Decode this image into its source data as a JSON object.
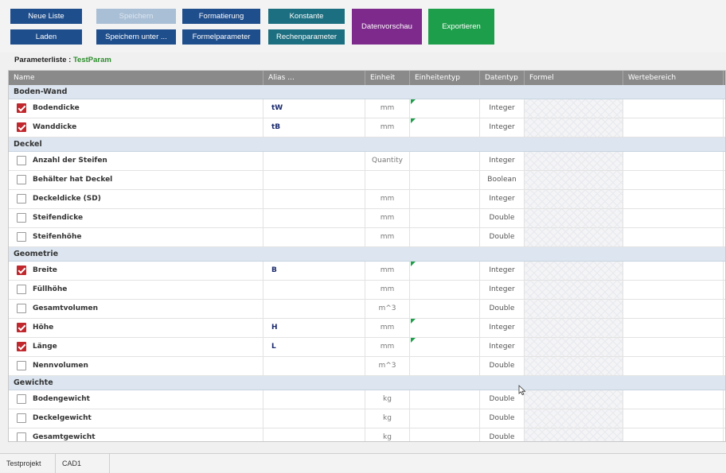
{
  "toolbar": {
    "neue_liste": "Neue Liste",
    "speichern": "Speichern",
    "formatierung": "Formatierung",
    "konstante": "Konstante",
    "laden": "Laden",
    "speichern_unter": "Speichern unter ...",
    "formelparameter": "Formelparameter",
    "rechenparameter": "Rechenparameter",
    "datenvorschau": "Datenvorschau",
    "exportieren": "Exportieren"
  },
  "param_list": {
    "label": "Parameterliste :",
    "name": "TestParam"
  },
  "columns": {
    "name": "Name",
    "alias": "Alias ...",
    "einheit": "Einheit",
    "einheitentyp": "Einheitentyp",
    "datentyp": "Datentyp",
    "formel": "Formel",
    "wertebereich": "Wertebereich"
  },
  "groups": [
    {
      "label": "Boden-Wand",
      "rows": [
        {
          "name": "Bodendicke",
          "checked": true,
          "alias": "tW",
          "unit": "mm",
          "dtype": "Integer",
          "marker": true
        },
        {
          "name": "Wanddicke",
          "checked": true,
          "alias": "tB",
          "unit": "mm",
          "dtype": "Integer",
          "marker": true
        }
      ]
    },
    {
      "label": "Deckel",
      "rows": [
        {
          "name": "Anzahl der Steifen",
          "checked": false,
          "alias": "",
          "unit": "Quantity",
          "dtype": "Integer",
          "marker": false
        },
        {
          "name": "Behälter hat Deckel",
          "checked": false,
          "alias": "",
          "unit": "",
          "dtype": "Boolean",
          "marker": false
        },
        {
          "name": "Deckeldicke (SD)",
          "checked": false,
          "alias": "",
          "unit": "mm",
          "dtype": "Integer",
          "marker": false
        },
        {
          "name": "Steifendicke",
          "checked": false,
          "alias": "",
          "unit": "mm",
          "dtype": "Double",
          "marker": false
        },
        {
          "name": "Steifenhöhe",
          "checked": false,
          "alias": "",
          "unit": "mm",
          "dtype": "Double",
          "marker": false
        }
      ]
    },
    {
      "label": "Geometrie",
      "rows": [
        {
          "name": "Breite",
          "checked": true,
          "alias": "B",
          "unit": "mm",
          "dtype": "Integer",
          "marker": true
        },
        {
          "name": "Füllhöhe",
          "checked": false,
          "alias": "",
          "unit": "mm",
          "dtype": "Integer",
          "marker": false
        },
        {
          "name": "Gesamtvolumen",
          "checked": false,
          "alias": "",
          "unit": "m^3",
          "dtype": "Double",
          "marker": false
        },
        {
          "name": "Höhe",
          "checked": true,
          "alias": "H",
          "unit": "mm",
          "dtype": "Integer",
          "marker": true
        },
        {
          "name": "Länge",
          "checked": true,
          "alias": "L",
          "unit": "mm",
          "dtype": "Integer",
          "marker": true
        },
        {
          "name": "Nennvolumen",
          "checked": false,
          "alias": "",
          "unit": "m^3",
          "dtype": "Double",
          "marker": false
        }
      ]
    },
    {
      "label": "Gewichte",
      "rows": [
        {
          "name": "Bodengewicht",
          "checked": false,
          "alias": "",
          "unit": "kg",
          "dtype": "Double",
          "marker": false
        },
        {
          "name": "Deckelgewicht",
          "checked": false,
          "alias": "",
          "unit": "kg",
          "dtype": "Double",
          "marker": false
        },
        {
          "name": "Gesamtgewicht",
          "checked": false,
          "alias": "",
          "unit": "kg",
          "dtype": "Double",
          "marker": false
        }
      ]
    }
  ],
  "tabs": [
    "Testprojekt",
    "CAD1"
  ],
  "colors": {
    "button_blue": "#1f4e8c",
    "button_teal": "#1c6f80",
    "button_purple": "#7e2a8c",
    "button_green": "#1d9e4a",
    "checkbox_checked": "#c0282e",
    "group_bg": "#dde6f0"
  }
}
